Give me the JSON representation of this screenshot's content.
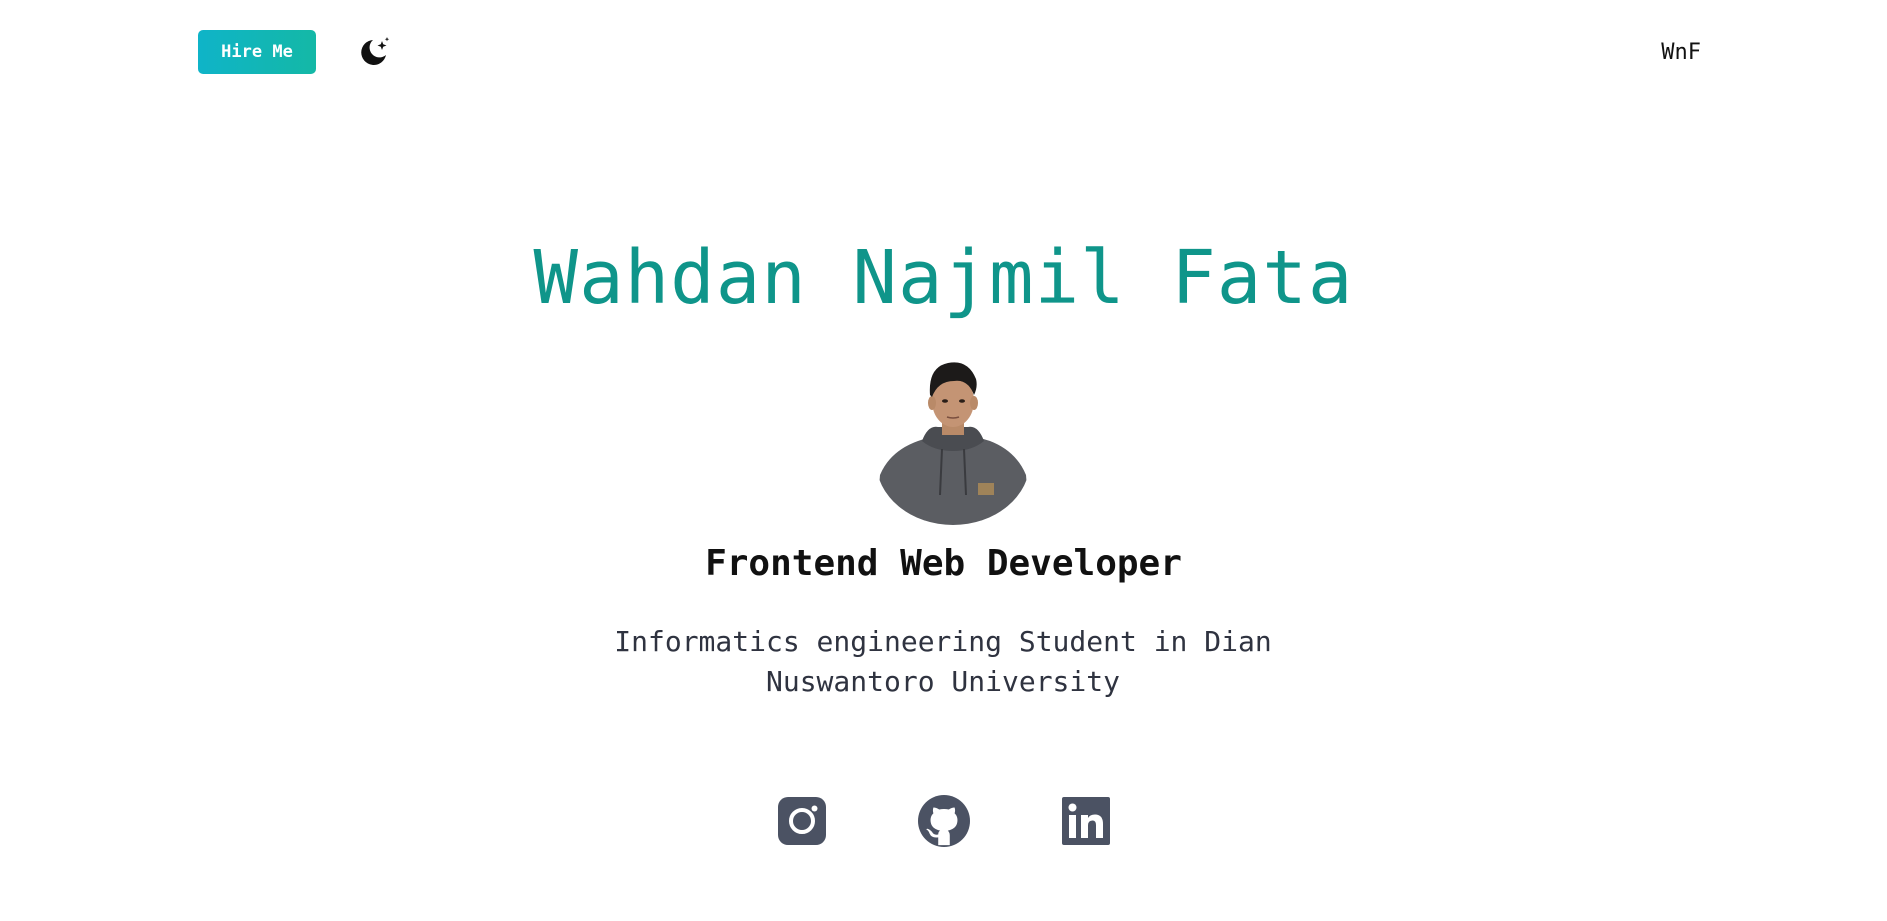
{
  "header": {
    "hire_label": "Hire Me",
    "theme_icon": "moon-stars-icon",
    "brand": "WnF"
  },
  "hero": {
    "name": "Wahdan Najmil Fata",
    "role": "Frontend Web Developer",
    "bio": "Informatics engineering Student in Dian Nuswantoro University"
  },
  "socials": [
    {
      "icon": "instagram-icon",
      "name": "Instagram"
    },
    {
      "icon": "github-icon",
      "name": "GitHub"
    },
    {
      "icon": "linkedin-icon",
      "name": "LinkedIn"
    }
  ],
  "colors": {
    "accent": "#0f958a",
    "button_start": "#0fb4c8",
    "button_end": "#14b8a6",
    "icon": "#4b5263"
  }
}
